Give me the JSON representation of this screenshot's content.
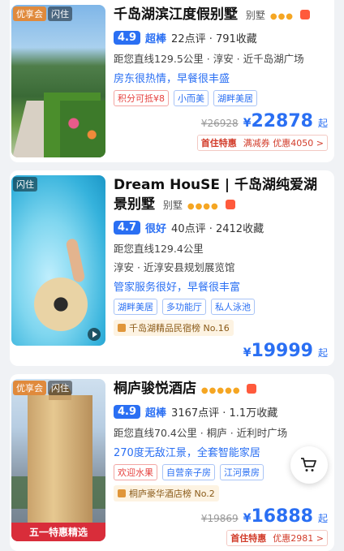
{
  "colors": {
    "accent": "#2a6ff3",
    "price": "#2a6ff3",
    "promo": "#d23c2a",
    "stars": "#f5a623"
  },
  "hotels": [
    {
      "tags": [
        "优享会",
        "闪住"
      ],
      "name": "千岛湖滨江度假别墅",
      "type": "别墅",
      "stars": "●●●",
      "score": "4.9",
      "score_label": "超棒",
      "reviews": "22点评 · 791收藏",
      "distance": "距您直线129.5公里 · 淳安 · 近千岛湖广场",
      "highlight": "房东很热情，早餐很丰盛",
      "chips": [
        "积分可抵¥8",
        "小而美",
        "湖畔美居"
      ],
      "old_price": "¥26928",
      "price_symbol": "¥",
      "price": "22878",
      "price_suffix": "起",
      "promo_brand": "首住特惠",
      "promo_text": "满减券 优惠4050 >"
    },
    {
      "tags": [
        "闪住"
      ],
      "name": "Dream HouSE | 千岛湖纯爱湖景别墅",
      "type": "别墅",
      "stars": "●●●●",
      "score": "4.7",
      "score_label": "很好",
      "reviews": "40点评 · 2412收藏",
      "distance": "距您直线129.4公里",
      "distance2": "淳安 · 近淳安县规划展览馆",
      "highlight": "管家服务很好，早餐很丰富",
      "chips": [
        "湖畔美居",
        "多功能厅",
        "私人泳池"
      ],
      "rank": "千岛湖精品民宿榜 No.16",
      "price_symbol": "¥",
      "price": "19999",
      "price_suffix": "起"
    },
    {
      "tags": [
        "优享会",
        "闪住"
      ],
      "name": "桐庐骏悦酒店",
      "stars": "●●●●●",
      "score": "4.9",
      "score_label": "超棒",
      "reviews": "3167点评 · 1.1万收藏",
      "distance": "距您直线70.4公里 · 桐庐 · 近利时广场",
      "highlight": "270度无敌江景，全套智能家居",
      "chips": [
        "欢迎水果",
        "自营亲子房",
        "江河景房"
      ],
      "rank": "桐庐豪华酒店榜 No.2",
      "banner": "五一特惠精选",
      "old_price": "¥19869",
      "price_symbol": "¥",
      "price": "16888",
      "price_suffix": "起",
      "promo_brand": "首住特惠",
      "promo_text": "优惠2981 >"
    }
  ],
  "icons": {
    "cart": "shopping-cart-icon",
    "play": "video-play-icon"
  }
}
